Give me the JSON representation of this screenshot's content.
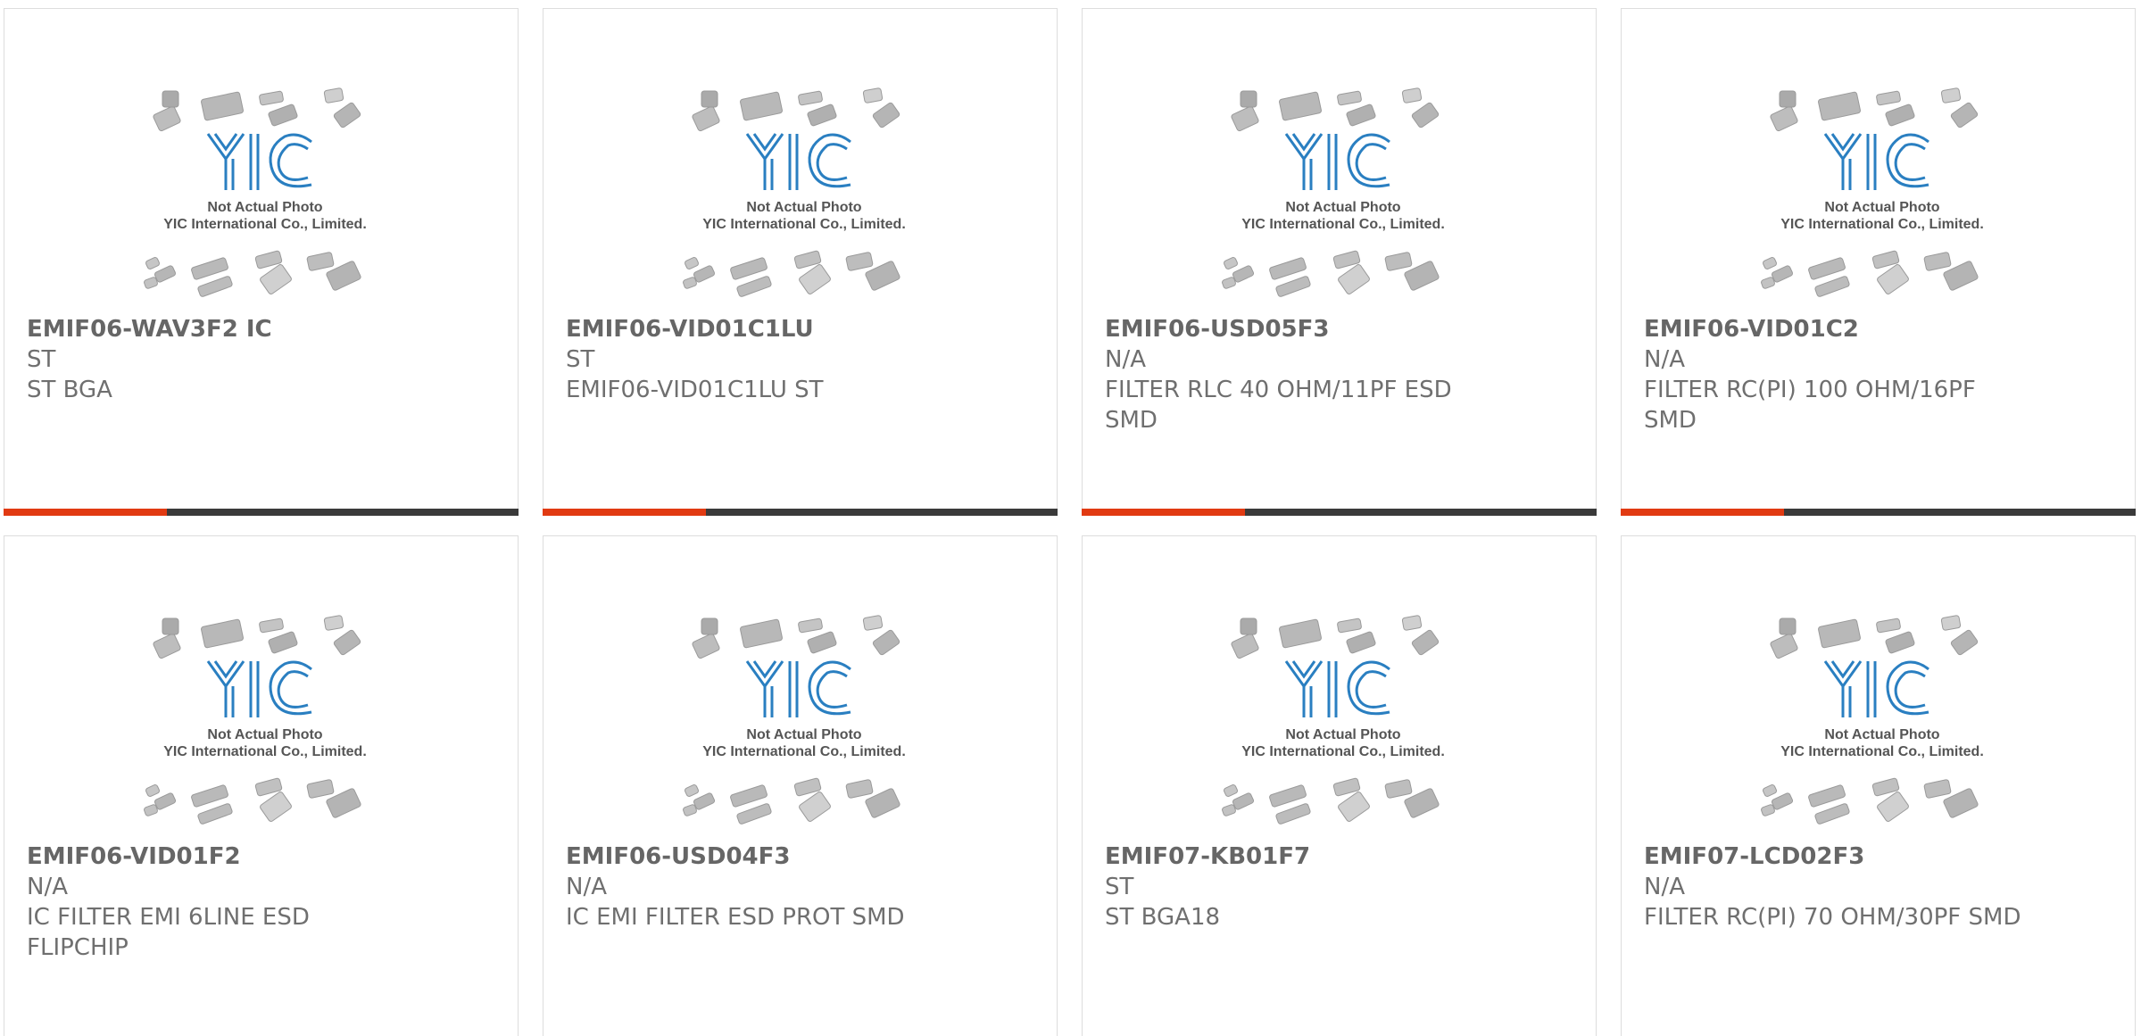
{
  "colors": {
    "accent": "#e13a12",
    "bar": "#3a3a3a",
    "logo": "#2a7fc1"
  },
  "placeholder": {
    "logo_text": "YIC",
    "line1": "Not Actual Photo",
    "line2": "YIC International Co., Limited."
  },
  "products": [
    {
      "part": "EMIF06-WAV3F2 IC",
      "brand": "ST",
      "desc": "ST BGA",
      "desc2": "",
      "has_bar": true
    },
    {
      "part": "EMIF06-VID01C1LU",
      "brand": "ST",
      "desc": "EMIF06-VID01C1LU ST",
      "desc2": "",
      "has_bar": true
    },
    {
      "part": "EMIF06-USD05F3",
      "brand": "N/A",
      "desc": "FILTER RLC 40 OHM/11PF ESD",
      "desc2": "SMD",
      "has_bar": true
    },
    {
      "part": "EMIF06-VID01C2",
      "brand": "N/A",
      "desc": "FILTER RC(PI) 100 OHM/16PF",
      "desc2": "SMD",
      "has_bar": true
    },
    {
      "part": "EMIF06-VID01F2",
      "brand": "N/A",
      "desc": "IC FILTER EMI 6LINE ESD",
      "desc2": "FLIPCHIP",
      "has_bar": false
    },
    {
      "part": "EMIF06-USD04F3",
      "brand": "N/A",
      "desc": "IC EMI FILTER ESD PROT SMD",
      "desc2": "",
      "has_bar": false
    },
    {
      "part": "EMIF07-KB01F7",
      "brand": "ST",
      "desc": "ST BGA18",
      "desc2": "",
      "has_bar": false
    },
    {
      "part": "EMIF07-LCD02F3",
      "brand": "N/A",
      "desc": "FILTER RC(PI) 70 OHM/30PF SMD",
      "desc2": "",
      "has_bar": false
    }
  ]
}
